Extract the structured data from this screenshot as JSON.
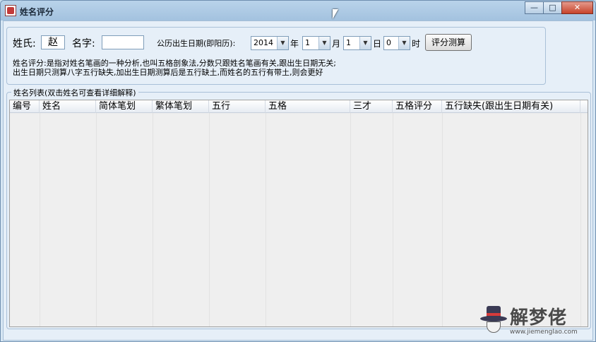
{
  "window": {
    "title": "姓名评分",
    "controls": {
      "minimize": "—",
      "maximize": "□",
      "close": "✕"
    }
  },
  "form": {
    "surname_label": "姓氏:",
    "surname_value": "赵",
    "given_label": "名字:",
    "given_value": "",
    "birthdate_label": "公历出生日期(即阳历):",
    "year": "2014",
    "year_unit": "年",
    "month": "1",
    "month_unit": "月",
    "day": "1",
    "day_unit": "日",
    "hour": "0",
    "hour_unit": "时",
    "submit_label": "评分测算",
    "desc_line1": "姓名评分:是指对姓名笔画的一种分析,也叫五格剖象法,分数只跟姓名笔画有关,跟出生日期无关;",
    "desc_line2": "出生日期只测算八字五行缺失,加出生日期测算后是五行缺土,而姓名的五行有带土,则会更好"
  },
  "list": {
    "group_title": "姓名列表(双击姓名可查看详细解释)",
    "columns": [
      "编号",
      "姓名",
      "简体笔划",
      "繁体笔划",
      "五行",
      "五格",
      "三才",
      "五格评分",
      "五行缺失(跟出生日期有关)"
    ],
    "rows": []
  },
  "watermark": {
    "brand": "解梦佬",
    "url": "www.jiemenglao.com"
  }
}
